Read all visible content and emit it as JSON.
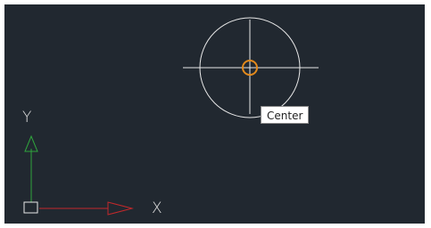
{
  "tooltip": {
    "text": "Center"
  },
  "ucs": {
    "x_label": "X",
    "y_label": "Y"
  },
  "colors": {
    "background": "#212830",
    "geometry": "#e8e8e8",
    "snap_marker": "#e38a1c",
    "x_axis": "#c3282b",
    "y_axis": "#2fa53d"
  },
  "icons": {
    "center_snap": "center-snap-marker-icon",
    "ucs": "ucs-icon"
  }
}
